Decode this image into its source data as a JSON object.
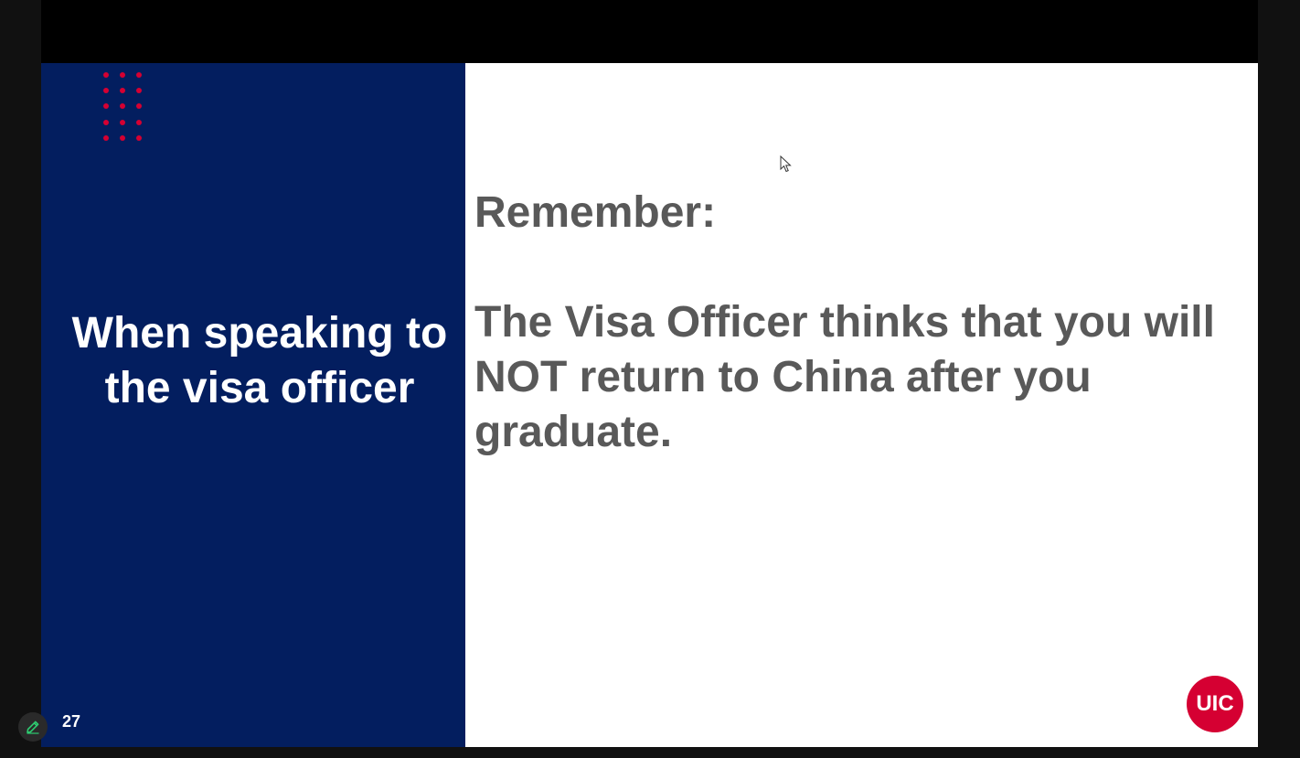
{
  "slide": {
    "left_title": "When speaking to the visa officer",
    "heading": "Remember:",
    "message": "The Visa Officer thinks that you will NOT return to China after you graduate.",
    "page_number": "27",
    "logo_text": "UIC"
  },
  "colors": {
    "left_panel": "#031e5f",
    "accent_dots": "#d50032",
    "body_text": "#595959",
    "logo_background": "#d50032"
  },
  "icons": {
    "edit": "pencil-icon",
    "pointer": "mouse-cursor-icon"
  }
}
